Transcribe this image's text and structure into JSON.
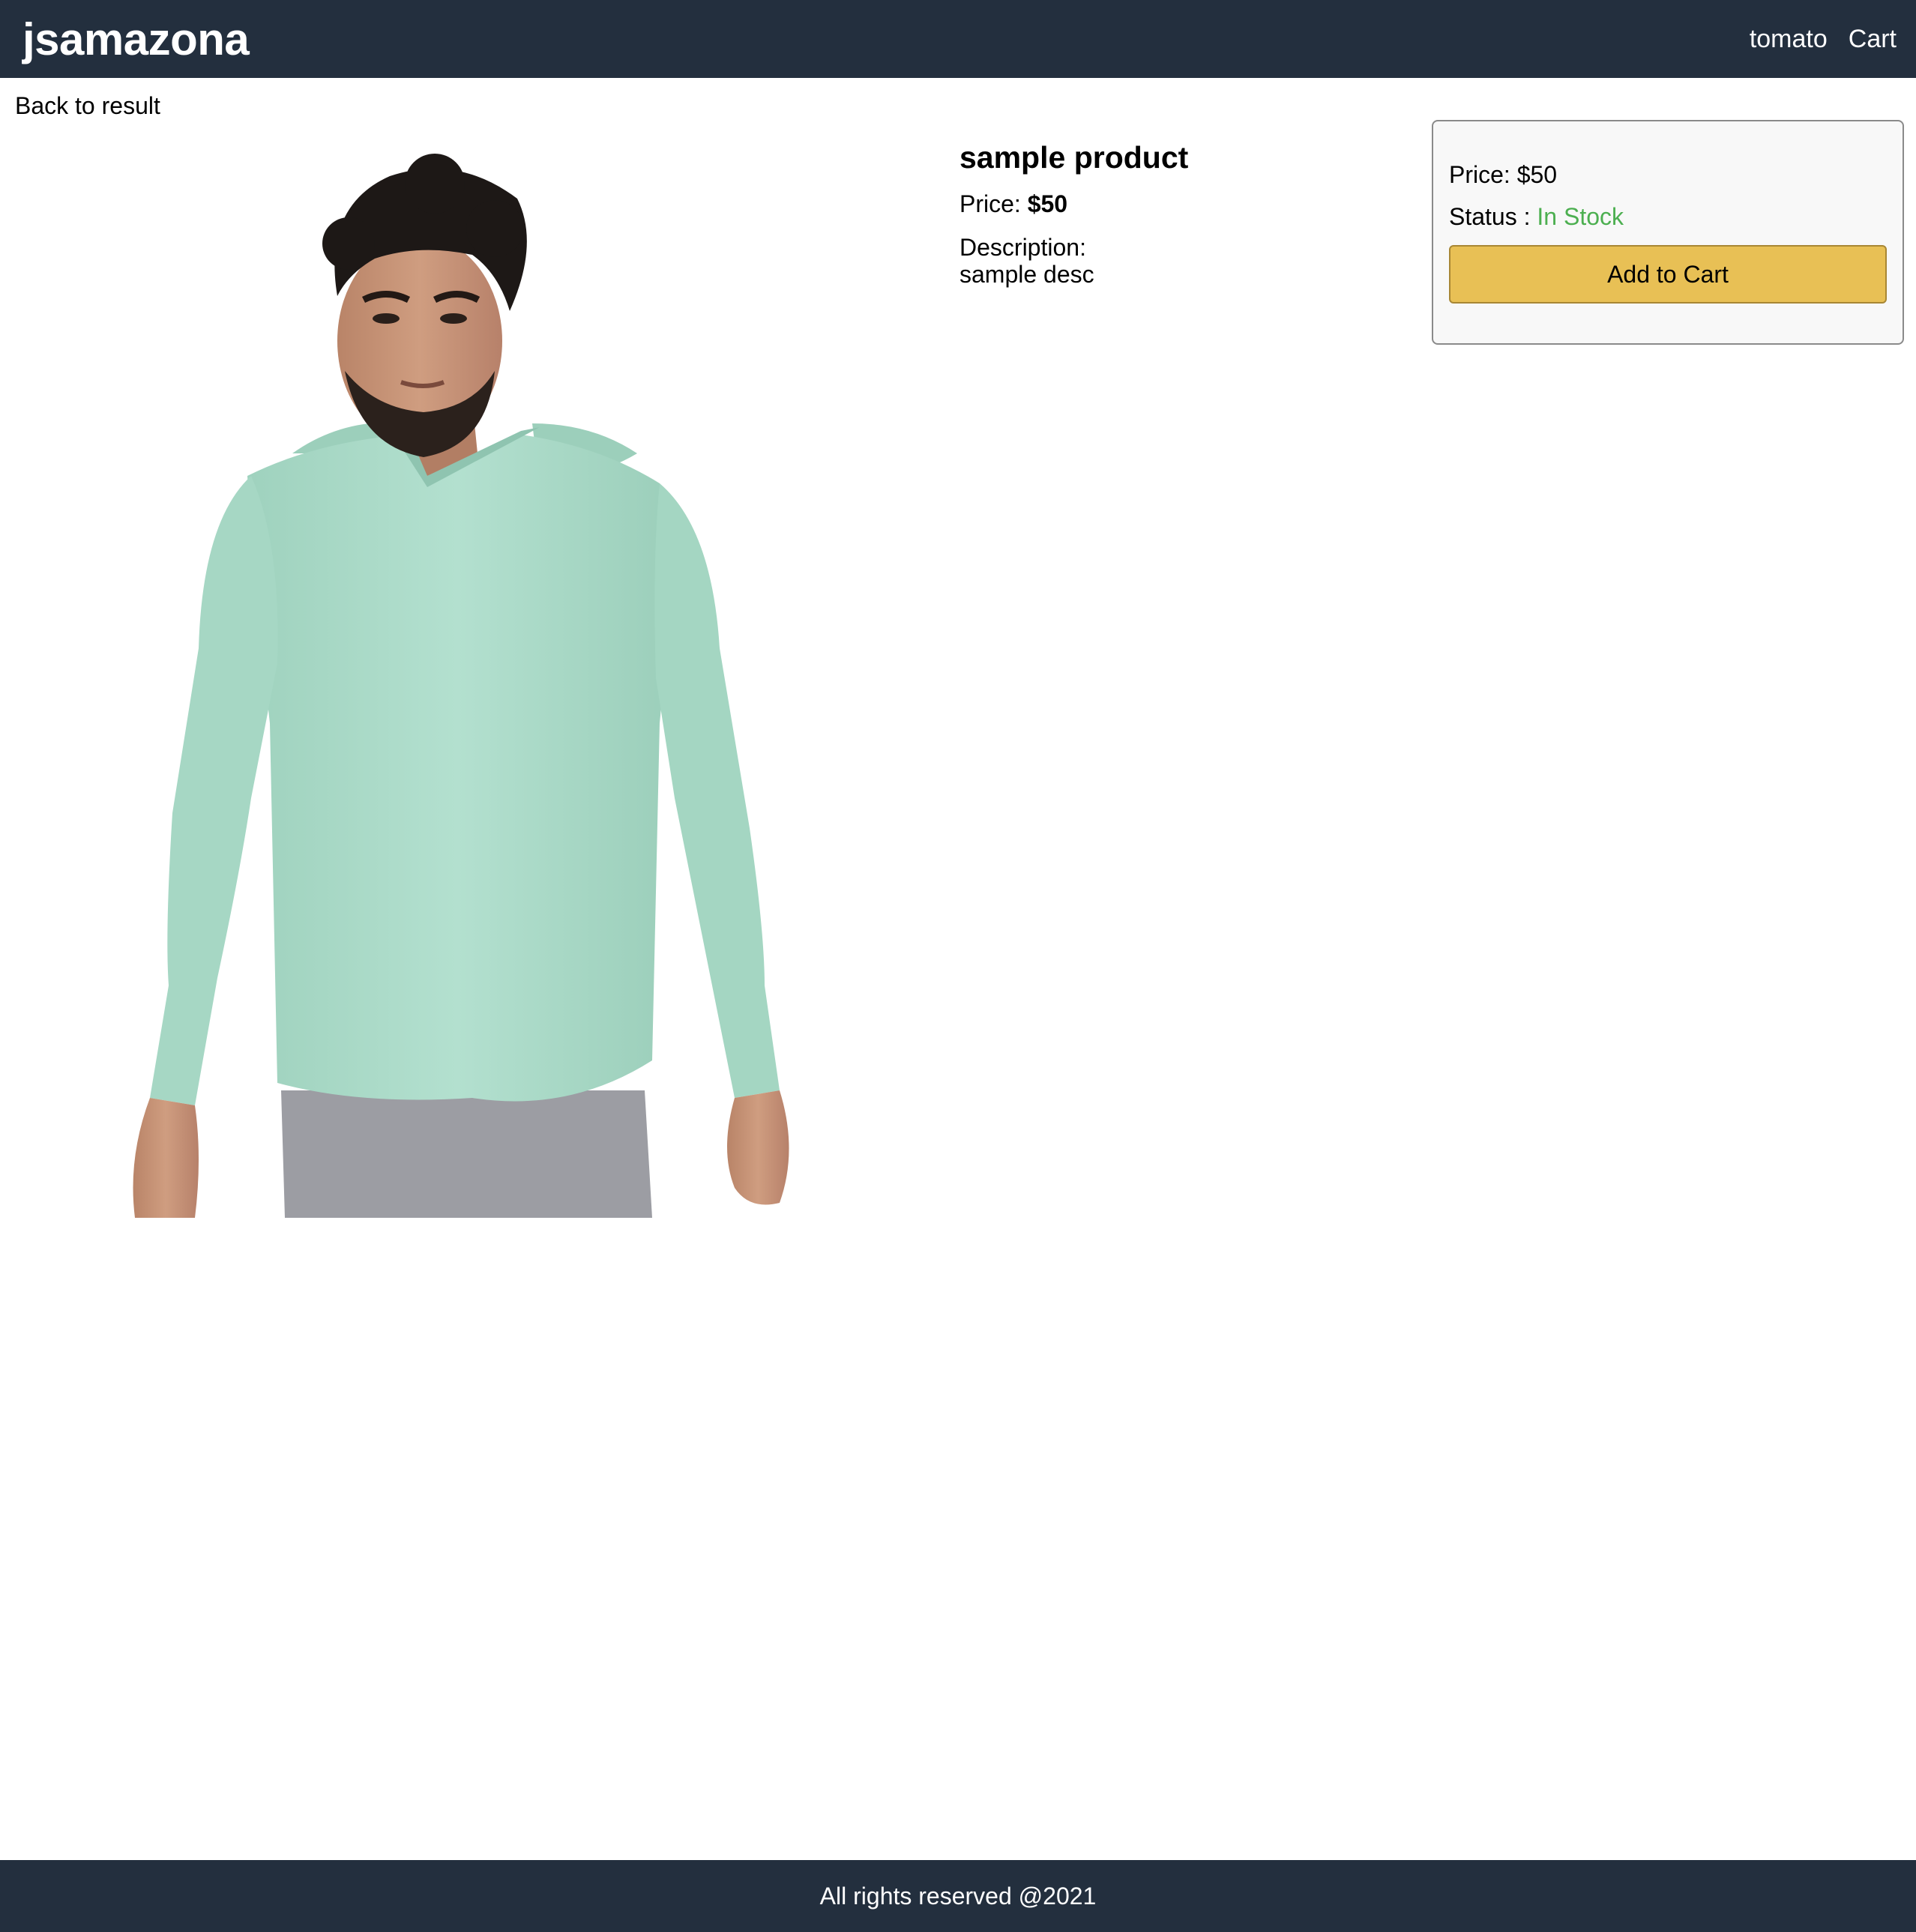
{
  "header": {
    "brand": "jsamazona",
    "nav": {
      "user": "tomato",
      "cart": "Cart"
    }
  },
  "back_link": "Back to result",
  "product": {
    "image_icon": "product-photo-hoodie",
    "name": "sample product",
    "price_label": "Price:",
    "price_value": "$50",
    "description_label": "Description:",
    "description": "sample desc"
  },
  "buy_box": {
    "price_label": "Price:",
    "price_value": "$50",
    "status_label": "Status :",
    "status_value": "In Stock",
    "add_to_cart": "Add to Cart"
  },
  "footer": {
    "text": "All rights reserved @2021"
  },
  "colors": {
    "header_bg": "#232f3e",
    "status_in_stock": "#4caf50",
    "button_bg": "#e8c055",
    "hoodie": "#a9d9c6"
  }
}
